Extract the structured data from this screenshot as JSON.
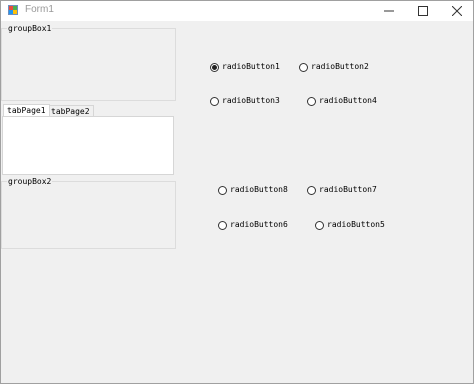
{
  "window": {
    "title": "Form1"
  },
  "titlebar": {
    "icon": "winforms-app-icon",
    "minimize_icon": "minimize-icon",
    "maximize_icon": "maximize-icon",
    "close_icon": "close-icon"
  },
  "groupBox1": {
    "caption": "groupBox1"
  },
  "groupBox2": {
    "caption": "groupBox2"
  },
  "tabControl": {
    "tabs": [
      {
        "label": "tabPage1",
        "selected": true
      },
      {
        "label": "tabPage2",
        "selected": false
      }
    ]
  },
  "radios": [
    {
      "label": "radioButton1",
      "checked": true
    },
    {
      "label": "radioButton2",
      "checked": false
    },
    {
      "label": "radioButton3",
      "checked": false
    },
    {
      "label": "radioButton4",
      "checked": false
    },
    {
      "label": "radioButton8",
      "checked": false
    },
    {
      "label": "radioButton7",
      "checked": false
    },
    {
      "label": "radioButton6",
      "checked": false
    },
    {
      "label": "radioButton5",
      "checked": false
    }
  ],
  "colors": {
    "form_background": "#f0f0f0",
    "titlebar_background": "#ffffff",
    "title_text": "#999999",
    "tab_panel_background": "#ffffff"
  }
}
